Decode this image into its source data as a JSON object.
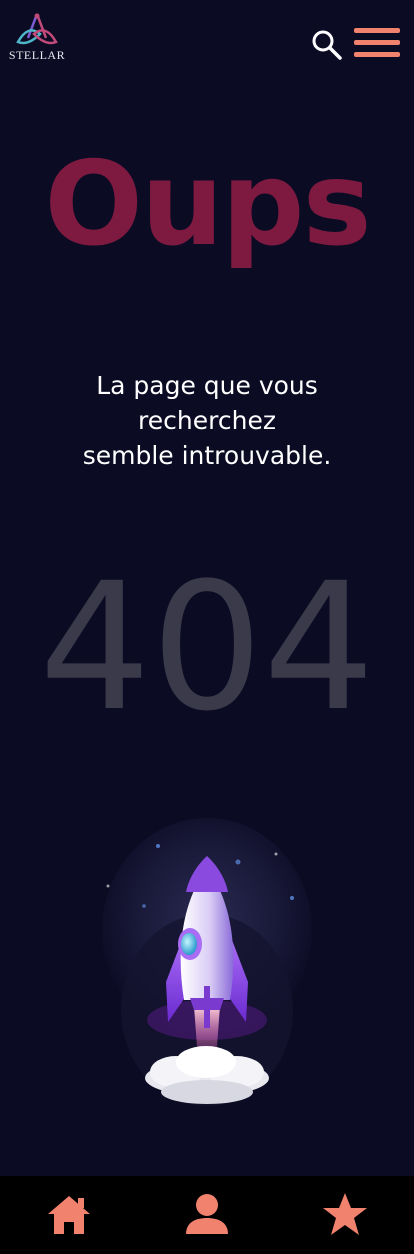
{
  "header": {
    "logo_text": "STELLAR",
    "logo_icon": "stellar-logo",
    "search_icon": "search-icon",
    "menu_icon": "hamburger-menu-icon"
  },
  "main": {
    "heading": "Oups",
    "message_line1": "La page que vous",
    "message_line2": "recherchez",
    "message_line3": "semble introuvable.",
    "error_code": "404",
    "illustration": "rocket-illustration"
  },
  "bottom_nav": {
    "items": [
      {
        "icon": "home-icon"
      },
      {
        "icon": "user-icon"
      },
      {
        "icon": "star-icon"
      }
    ]
  },
  "colors": {
    "background": "#0b0b24",
    "accent": "#f0826e",
    "heading": "#7e1a40",
    "error_code": "#3a3a4a"
  }
}
